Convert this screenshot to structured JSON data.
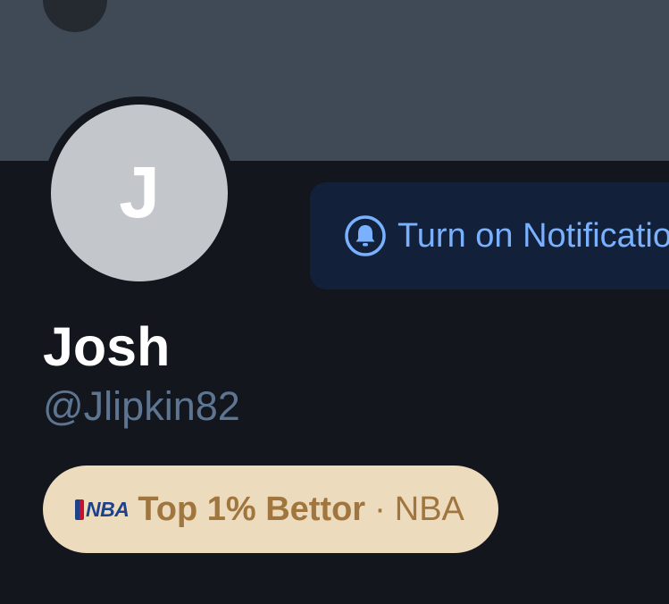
{
  "profile": {
    "initial": "J",
    "name": "Josh",
    "handle": "@Jlipkin82"
  },
  "actions": {
    "notifications_label": "Turn on Notifications",
    "notifications_icon": "bell-icon",
    "back_icon": "chevron-left-icon"
  },
  "badge": {
    "logo_text": "NBA",
    "title": "Top 1% Bettor",
    "separator": "·",
    "league": "NBA"
  },
  "colors": {
    "banner": "#3f4a56",
    "background": "#13161d",
    "notify_bg": "#122039",
    "notify_text": "#7ab1ff",
    "handle": "#5d7590",
    "badge_bg": "#eddbbe",
    "badge_text": "#a0763e",
    "nba_blue": "#1d428a",
    "nba_red": "#c8102e"
  }
}
